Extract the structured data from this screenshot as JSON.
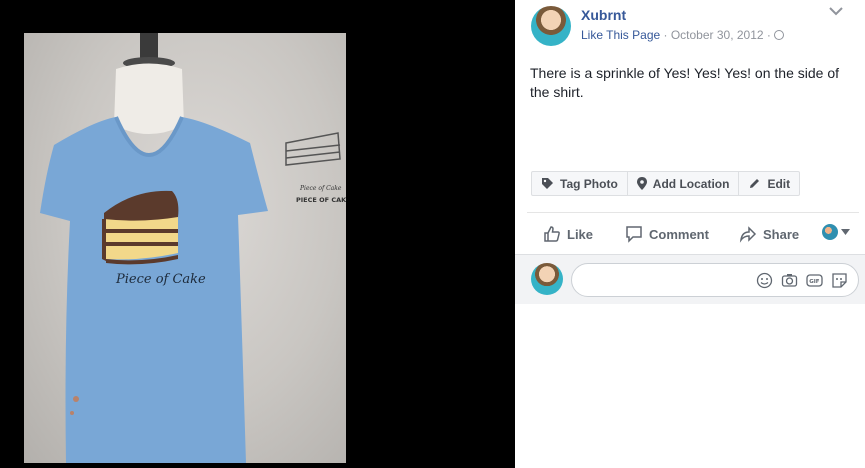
{
  "post": {
    "page_name": "Xubrnt",
    "like_page_label": "Like This Page",
    "separator": " · ",
    "date": "October 30, 2012",
    "caption": "There is a sprinkle of Yes! Yes! Yes! on the side of the shirt."
  },
  "photo": {
    "shirt_text": "Piece of Cake",
    "sleeve_text_1": "Piece of Cake",
    "sleeve_text_2": "PIECE OF CAKE"
  },
  "tag_bar": {
    "tag_photo": "Tag Photo",
    "add_location": "Add Location",
    "edit": "Edit"
  },
  "actions": {
    "like": "Like",
    "comment": "Comment",
    "share": "Share"
  },
  "comment_box": {
    "placeholder": ""
  },
  "icons": [
    "chevron-down-icon",
    "globe-icon",
    "tag-icon",
    "location-pin-icon",
    "pencil-icon",
    "thumbs-up-icon",
    "comment-bubble-icon",
    "share-arrow-icon",
    "emoji-icon",
    "camera-icon",
    "gif-icon",
    "sticker-icon"
  ],
  "colors": {
    "link": "#365899",
    "muted": "#90949c",
    "shirt": "#79a7d6",
    "background": "#000000"
  }
}
